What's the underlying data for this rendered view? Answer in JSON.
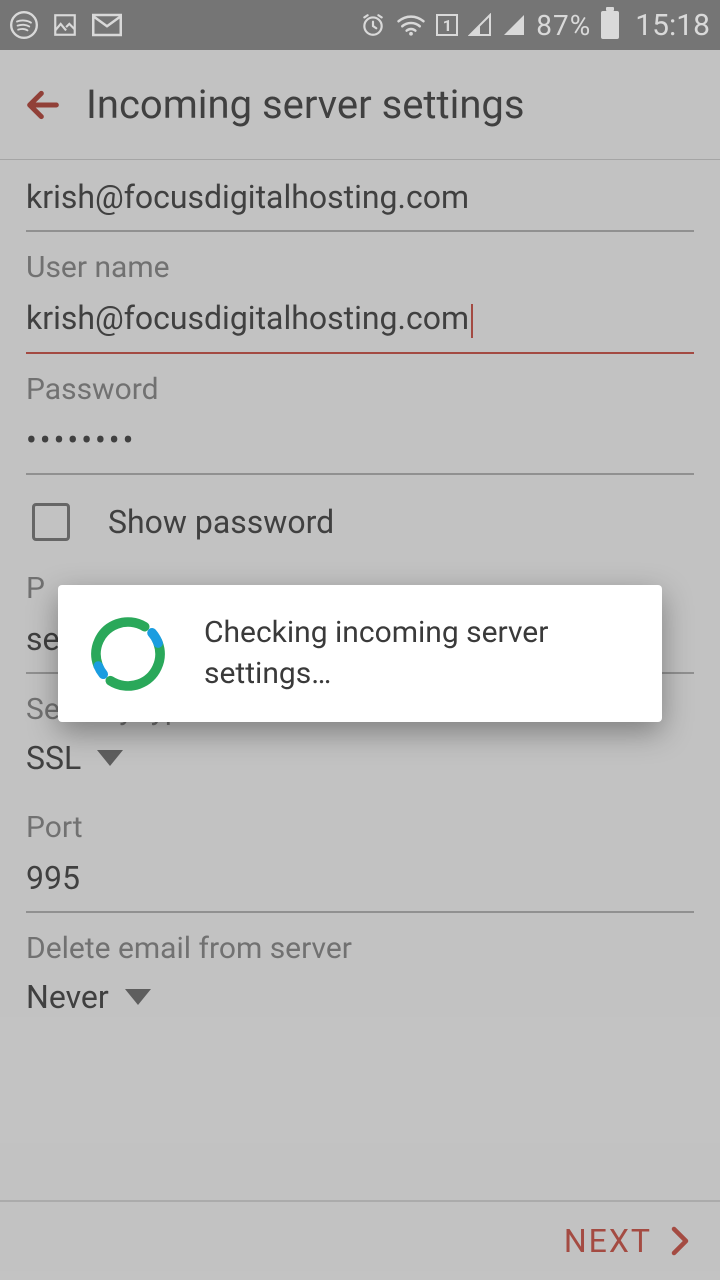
{
  "statusbar": {
    "battery_percent": "87%",
    "time": "15:18"
  },
  "appbar": {
    "title": "Incoming server settings"
  },
  "fields": {
    "email_value": "krish@focusdigitalhosting.com",
    "username_label": "User name",
    "username_value": "krish@focusdigitalhosting.com",
    "password_label": "Password",
    "password_value": "••••••••",
    "show_password_label": "Show password",
    "pop_server_label_partial": "P",
    "pop_server_value_partial": "se",
    "security_type_label": "Security type",
    "security_type_value": "SSL",
    "port_label": "Port",
    "port_value": "995",
    "delete_email_label": "Delete email from server",
    "delete_email_value": "Never"
  },
  "footer": {
    "next_label": "NEXT"
  },
  "dialog": {
    "message": "Checking incoming server settings…"
  }
}
